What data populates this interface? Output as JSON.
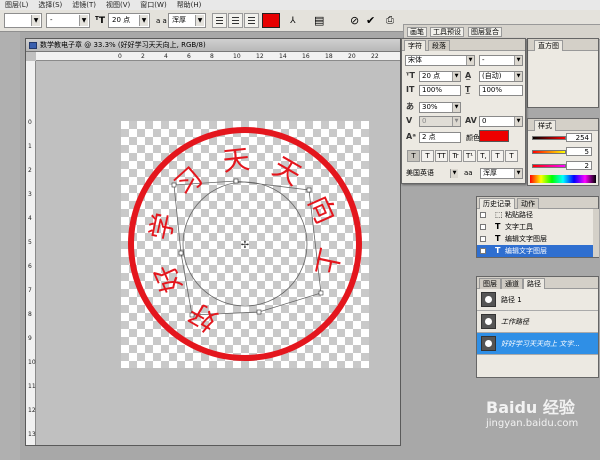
{
  "menu": [
    "图层(L)",
    "选择(S)",
    "滤镜(T)",
    "视图(V)",
    "窗口(W)",
    "帮助(H)"
  ],
  "options": {
    "font_style": "-",
    "size": "20 点",
    "aa_icon": "a a",
    "aa_mode": "浑厚",
    "cancel_icon": "⊘",
    "commit_icon": "✔",
    "text_color": "#e60000"
  },
  "well_tabs": [
    "画笔",
    "工具预设",
    "图层复合"
  ],
  "document": {
    "title": "数学教电子章 @ 33.3% (好好学习天天向上, RGB/8)",
    "ruler_h": [
      "0",
      "2",
      "4",
      "6",
      "8",
      "10",
      "12",
      "14",
      "16",
      "18",
      "20",
      "22"
    ],
    "ruler_v": [
      "0",
      "1",
      "2",
      "3",
      "4",
      "5",
      "6",
      "7",
      "8",
      "9",
      "10",
      "11",
      "12",
      "13"
    ]
  },
  "stamp": {
    "text": "好好学习天天向上",
    "ring_color": "#e4161d",
    "text_color": "#e4161d"
  },
  "character": {
    "tabs": [
      "字符",
      "段落"
    ],
    "font_family": "宋体",
    "font_style": "-",
    "size": "20 点",
    "leading": "(自动)",
    "vscale": "100%",
    "hscale": "100%",
    "tsume": "30%",
    "kerning": "0",
    "tracking": "0",
    "baseline": "2 点",
    "color_label": "颜色:",
    "color": "#ee0000",
    "buttons": [
      "T",
      "T",
      "TT",
      "Tr",
      "T¹",
      "T,",
      "T",
      "T"
    ],
    "language": "美国英语",
    "aa_icon": "aa",
    "aa_mode": "浑厚"
  },
  "nav_tabs": [
    "直方图"
  ],
  "color_panel": {
    "tab": "样式",
    "values": [
      "254",
      "5",
      "2"
    ]
  },
  "history": {
    "tabs": [
      "历史记录",
      "动作"
    ],
    "rows": [
      "粘贴路径",
      "文字工具",
      "编辑文字图层",
      "编辑文字图层"
    ],
    "selected": 3
  },
  "paths": {
    "tabs": [
      "图层",
      "通道",
      "路径"
    ],
    "rows": [
      "路径 1",
      "工作路径",
      "好好学习天天向上 文字..."
    ],
    "selected": 2
  },
  "watermark": {
    "brand": "Baidu 经验",
    "url": "jingyan.baidu.com"
  }
}
